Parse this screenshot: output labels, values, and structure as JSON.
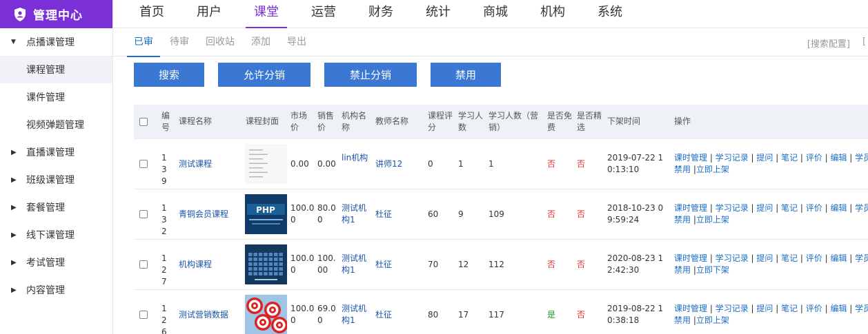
{
  "brand": {
    "title": "管理中心",
    "icon": "shield-user-icon"
  },
  "sidebar": {
    "groups": [
      {
        "label": "点播课管理",
        "expanded": true,
        "children": [
          "课程管理",
          "课件管理",
          "视频弹题管理"
        ]
      },
      {
        "label": "直播课管理"
      },
      {
        "label": "班级课管理"
      },
      {
        "label": "套餐管理"
      },
      {
        "label": "线下课管理"
      },
      {
        "label": "考试管理"
      },
      {
        "label": "内容管理"
      }
    ],
    "active": "课程管理"
  },
  "topnav": [
    "首页",
    "用户",
    "课堂",
    "运营",
    "财务",
    "统计",
    "商城",
    "机构",
    "系统"
  ],
  "topnav_active": "课堂",
  "subtabs": [
    "已审",
    "待审",
    "回收站",
    "添加",
    "导出"
  ],
  "subtab_active": "已审",
  "search_config": "[搜索配置]",
  "extra_bracket": "[",
  "buttons": [
    "搜索",
    "允许分销",
    "禁止分销",
    "禁用"
  ],
  "table": {
    "headers": {
      "id": "编号",
      "name": "课程名称",
      "cover": "课程封面",
      "market_price": "市场价",
      "sale_price": "销售价",
      "org": "机构名称",
      "teacher": "教师名称",
      "score": "课程评分",
      "learners": "学习人数",
      "learners_sales": "学习人数（营销）",
      "free": "是否免费",
      "featured": "是否精选",
      "offline_time": "下架时间",
      "ops": "操作"
    },
    "rows": [
      {
        "id": "139",
        "name": "测试课程",
        "cover": "text-doc",
        "market_price": "0.00",
        "sale_price": "0.00",
        "org": "lin机构",
        "teacher": "讲师12",
        "score": "0",
        "learners": "1",
        "learners_sales": "1",
        "free": "否",
        "featured": "否",
        "offline_time": "2019-07-22 10:13:10",
        "last_op": "立即上架"
      },
      {
        "id": "132",
        "name": "青铜会员课程",
        "cover": "php-poster",
        "market_price": "100.00",
        "sale_price": "80.00",
        "org": "测试机构1",
        "teacher": "杜征",
        "score": "60",
        "learners": "9",
        "learners_sales": "109",
        "free": "否",
        "featured": "否",
        "offline_time": "2018-10-23 09:59:24",
        "last_op": "立即上架"
      },
      {
        "id": "127",
        "name": "机构课程",
        "cover": "keyboard",
        "market_price": "100.00",
        "sale_price": "100.00",
        "org": "测试机构1",
        "teacher": "杜征",
        "score": "70",
        "learners": "12",
        "learners_sales": "112",
        "free": "否",
        "featured": "否",
        "offline_time": "2020-08-23 12:42:30",
        "last_op": "立即下架"
      },
      {
        "id": "126",
        "name": "测试营销数据",
        "cover": "targets",
        "market_price": "100.00",
        "sale_price": "69.00",
        "org": "测试机构1",
        "teacher": "杜征",
        "score": "80",
        "learners": "17",
        "learners_sales": "117",
        "free": "是",
        "featured": "否",
        "offline_time": "2019-08-22 10:38:18",
        "last_op": "立即上架"
      }
    ],
    "ops": [
      "课时管理",
      "学习记录",
      "提问",
      "笔记",
      "评价",
      "编辑",
      "学员",
      "禁用"
    ]
  },
  "colors": {
    "brand": "#7b2fd6",
    "button": "#3b78d4",
    "link": "#1a6dc8",
    "no": "#e03030",
    "yes": "#1c9a2b"
  }
}
